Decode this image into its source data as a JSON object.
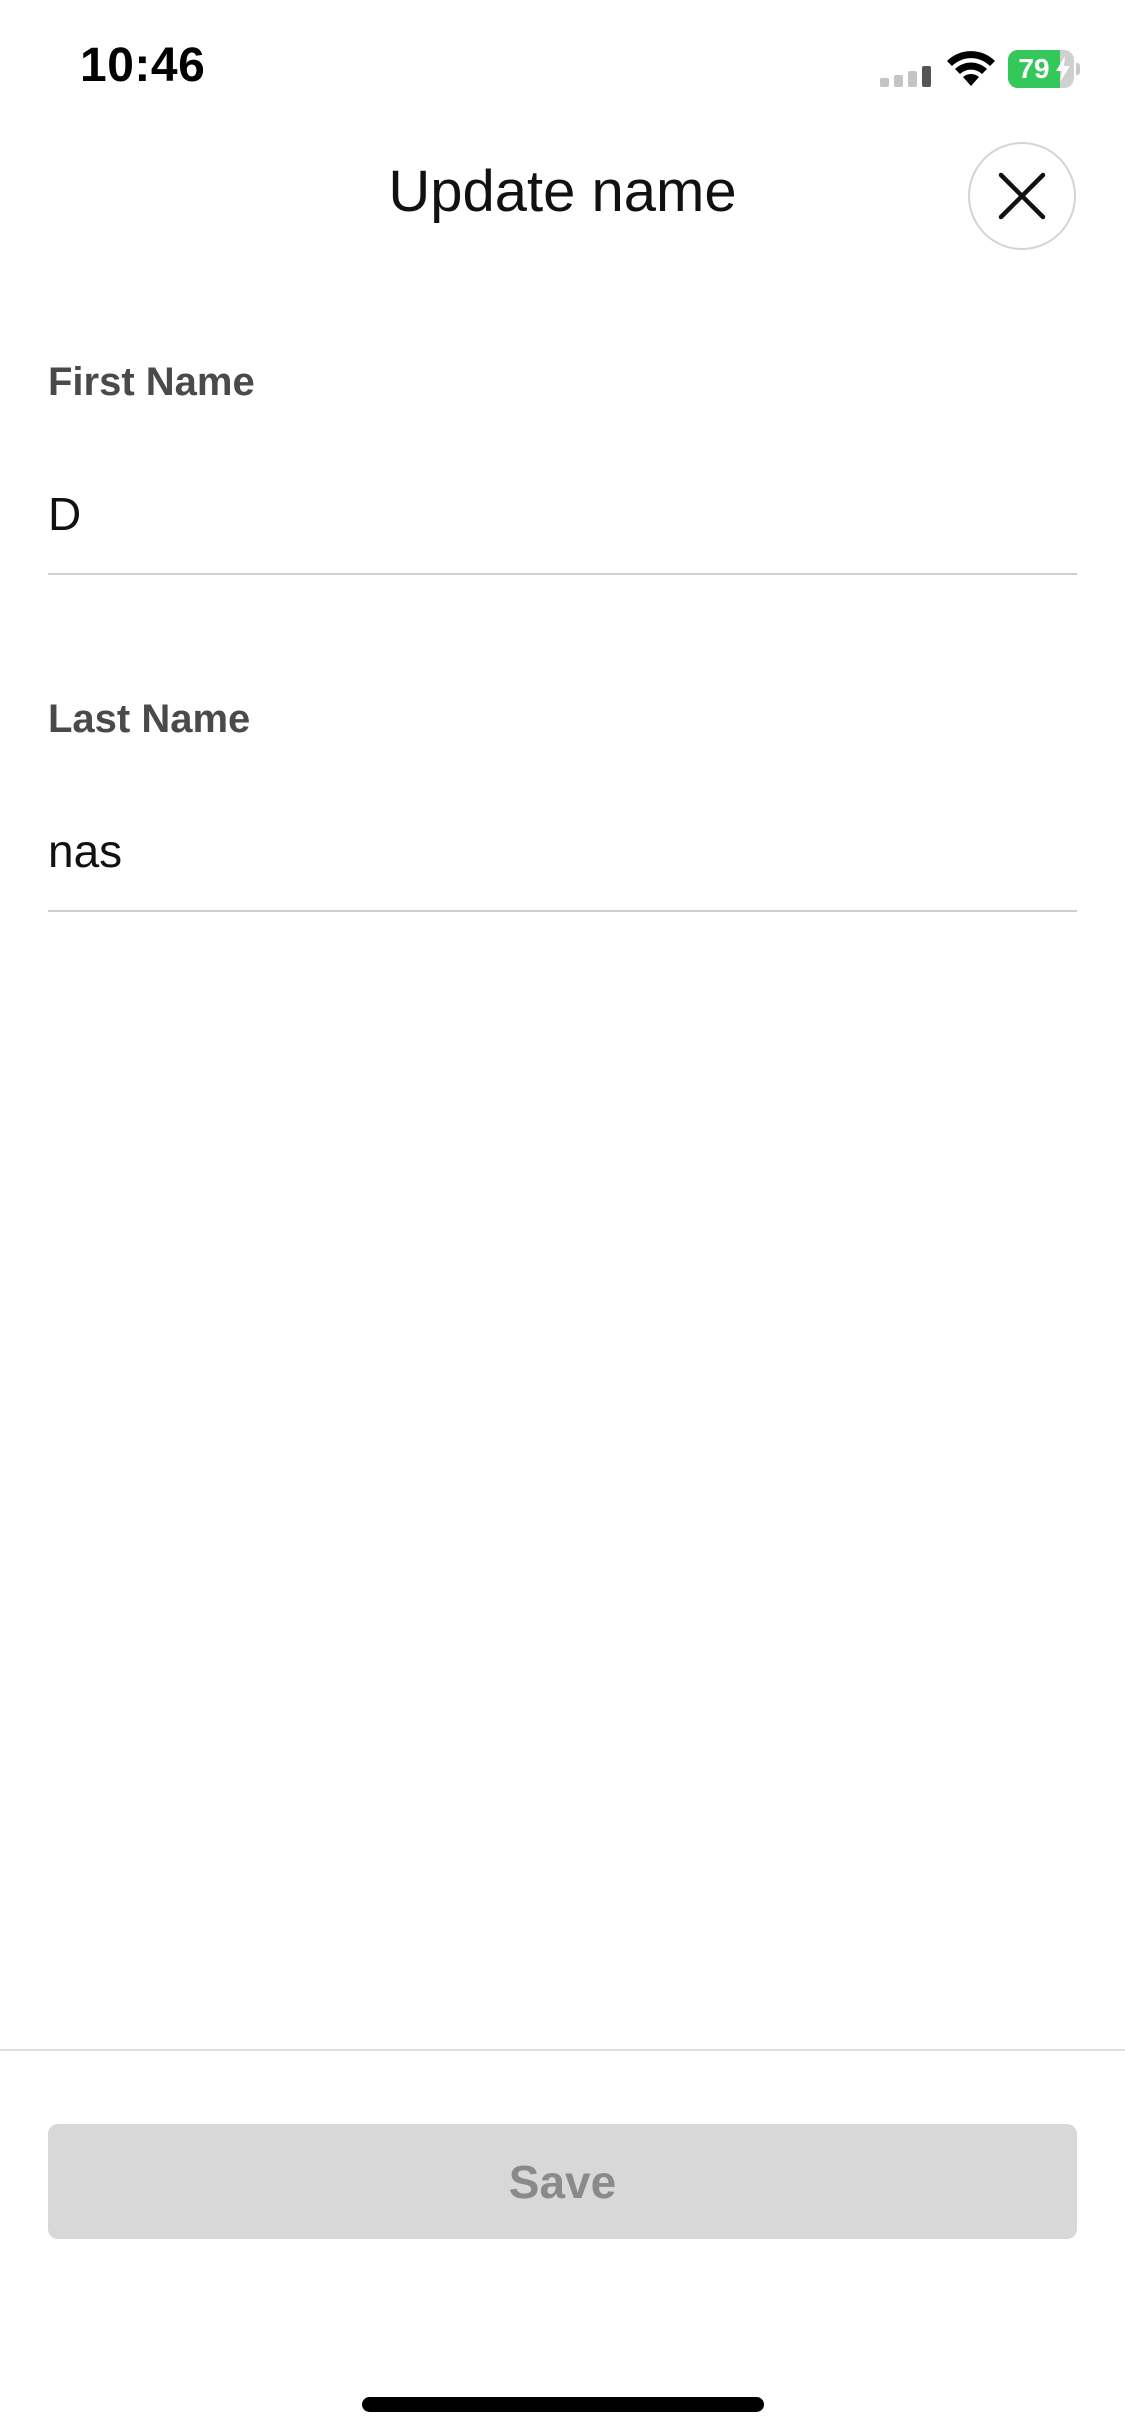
{
  "status_bar": {
    "time": "10:46",
    "battery_level": 79,
    "battery_text": "79",
    "battery_color": "#34c759",
    "icons": [
      "signal-icon",
      "wifi-icon",
      "battery-icon",
      "charging-bolt-icon"
    ]
  },
  "header": {
    "title": "Update name",
    "close_icon": "close-icon"
  },
  "form": {
    "first_name": {
      "label": "First Name",
      "value": "D"
    },
    "last_name": {
      "label": "Last Name",
      "value": "nas"
    }
  },
  "footer": {
    "save_label": "Save"
  }
}
